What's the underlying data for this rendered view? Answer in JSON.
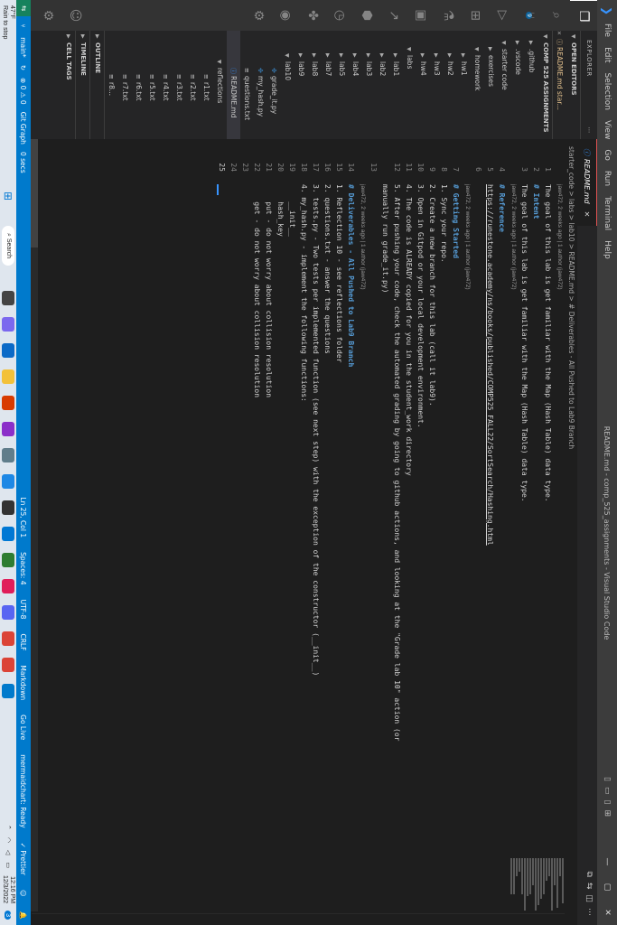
{
  "window": {
    "menu": [
      "File",
      "Edit",
      "Selection",
      "View",
      "Go",
      "Run",
      "Terminal",
      "Help"
    ],
    "title": "README.md - comp_525_assignments - Visual Studio Code"
  },
  "explorer": {
    "header": "EXPLORER",
    "open_editors_label": "OPEN EDITORS",
    "open_editor_item": "README.md  star...",
    "workspace_label": "COMP 525 ASSIGNMENTS",
    "tree": [
      {
        "name": ".github",
        "type": "folder",
        "depth": 1,
        "open": false
      },
      {
        "name": ".vscode",
        "type": "folder",
        "depth": 1,
        "open": false
      },
      {
        "name": "starter code",
        "type": "folder",
        "depth": 1,
        "open": true
      },
      {
        "name": "exercises",
        "type": "folder",
        "depth": 2,
        "open": false
      },
      {
        "name": "homework",
        "type": "folder",
        "depth": 2,
        "open": true
      },
      {
        "name": "hw1",
        "type": "folder",
        "depth": 3,
        "open": false
      },
      {
        "name": "hw2",
        "type": "folder",
        "depth": 3,
        "open": false
      },
      {
        "name": "hw3",
        "type": "folder",
        "depth": 3,
        "open": false
      },
      {
        "name": "hw4",
        "type": "folder",
        "depth": 3,
        "open": false
      },
      {
        "name": "labs",
        "type": "folder",
        "depth": 2,
        "open": true
      },
      {
        "name": "lab1",
        "type": "folder",
        "depth": 3,
        "open": false
      },
      {
        "name": "lab2",
        "type": "folder",
        "depth": 3,
        "open": false
      },
      {
        "name": "lab3",
        "type": "folder",
        "depth": 3,
        "open": false
      },
      {
        "name": "lab4",
        "type": "folder",
        "depth": 3,
        "open": false
      },
      {
        "name": "lab5",
        "type": "folder",
        "depth": 3,
        "open": false
      },
      {
        "name": "lab7",
        "type": "folder",
        "depth": 3,
        "open": false
      },
      {
        "name": "lab8",
        "type": "folder",
        "depth": 3,
        "open": false
      },
      {
        "name": "lab9",
        "type": "folder",
        "depth": 3,
        "open": false
      },
      {
        "name": "lab10",
        "type": "folder",
        "depth": 3,
        "open": true
      },
      {
        "name": "grade_it.py",
        "type": "py",
        "depth": 4
      },
      {
        "name": "my_hash.py",
        "type": "py",
        "depth": 4
      },
      {
        "name": "questions.txt",
        "type": "txt",
        "depth": 4
      },
      {
        "name": "README.md",
        "type": "md",
        "depth": 4,
        "selected": true
      },
      {
        "name": "reflections",
        "type": "folder",
        "depth": 4,
        "open": true
      },
      {
        "name": "r1.txt",
        "type": "txt",
        "depth": 5
      },
      {
        "name": "r2.txt",
        "type": "txt",
        "depth": 5
      },
      {
        "name": "r3.txt",
        "type": "txt",
        "depth": 5
      },
      {
        "name": "r4.txt",
        "type": "txt",
        "depth": 5
      },
      {
        "name": "r5.txt",
        "type": "txt",
        "depth": 5
      },
      {
        "name": "r6.txt",
        "type": "txt",
        "depth": 5
      },
      {
        "name": "r7.txt",
        "type": "txt",
        "depth": 5
      },
      {
        "name": "r8...",
        "type": "txt",
        "depth": 5
      }
    ],
    "sections": [
      "OUTLINE",
      "TIMELINE",
      "CELL TAGS"
    ]
  },
  "editor": {
    "tab_label": "README.md",
    "breadcrumb": "starter_code > labs > lab10 > README.md > # Deliverables - All Pushed to Lab9 Branch",
    "lines": [
      {
        "n": "1",
        "lens": "jaw472, 2 weeks ago | 1 author (jaw472)",
        "text": "The goal of this lab is get familiar with the Map (Hash Table) data type.",
        "kind": "txt"
      },
      {
        "n": "2",
        "text": "# Intent",
        "kind": "h"
      },
      {
        "n": "3",
        "text": "The goal of this lab is get familiar with the Map (Hash Table) data type.",
        "kind": "txt"
      },
      {
        "n": "",
        "lens": "jaw472, 2 weeks ago | 1 author (jaw472)",
        "text": "",
        "kind": "txt"
      },
      {
        "n": "4",
        "text": "# Reference",
        "kind": "h"
      },
      {
        "n": "5",
        "text": "https://runestone.academy/ns/books/published/COMP525_FALL22/SortSearch/Hashing.html",
        "kind": "link"
      },
      {
        "n": "6",
        "text": "",
        "kind": "txt"
      },
      {
        "n": "",
        "lens": "jaw472, 2 weeks ago | 1 author (jaw472)",
        "text": "",
        "kind": "txt"
      },
      {
        "n": "7",
        "text": "# Getting Started",
        "kind": "h"
      },
      {
        "n": "8",
        "text": "1. Sync your repo.",
        "kind": "li"
      },
      {
        "n": "9",
        "text": "2. Create a new branch for this lab (call it lab9).",
        "kind": "li"
      },
      {
        "n": "10",
        "text": "3. Open in Gitpod or your local development environment.",
        "kind": "li"
      },
      {
        "n": "11",
        "text": "4. The code is ALREADY copied for you in the student_work directory",
        "kind": "li"
      },
      {
        "n": "12",
        "text": "5. After pushing your code, check the automated grading by going to github actions, and looking at the \"Grade lab 10\" action (or",
        "kind": "li"
      },
      {
        "n": "",
        "text": "manually run grade_it.py)",
        "kind": "txt"
      },
      {
        "n": "13",
        "text": "",
        "kind": "txt"
      },
      {
        "n": "",
        "lens": "jaw472, 2 weeks ago | 1 author (jaw472)",
        "text": "",
        "kind": "txt"
      },
      {
        "n": "14",
        "text": "# Deliverables - All Pushed to Lab9 Branch",
        "kind": "h"
      },
      {
        "n": "15",
        "text": "1. Reflection 10 - see reflections folder",
        "kind": "li"
      },
      {
        "n": "16",
        "text": "2. questions.txt - answer the questions",
        "kind": "li"
      },
      {
        "n": "17",
        "text": "3. tests.py - Two tests per implemented function (see next step) with the exception of the constructor (__init__)",
        "kind": "li"
      },
      {
        "n": "18",
        "text": "4. my_hash.py - implement the following functions:",
        "kind": "li"
      },
      {
        "n": "19",
        "text": "    __init__",
        "kind": "txt"
      },
      {
        "n": "20",
        "text": "    hash_key",
        "kind": "txt"
      },
      {
        "n": "21",
        "text": "    put - do not worry about collision resolution",
        "kind": "txt"
      },
      {
        "n": "22",
        "text": "    get - do not worry about collision resolution",
        "kind": "txt"
      },
      {
        "n": "23",
        "text": "",
        "kind": "txt"
      },
      {
        "n": "24",
        "text": "",
        "kind": "txt"
      },
      {
        "n": "25",
        "text": "",
        "kind": "cur"
      }
    ]
  },
  "statusbar": {
    "branch": "main*",
    "sync": "↻",
    "problems": "⊗ 0 ⚠ 0",
    "git_graph": "Git Graph",
    "timer": "0 secs",
    "cursor_pos": "Ln 25, Col 1",
    "spaces": "Spaces: 4",
    "encoding": "UTF-8",
    "eol": "CRLF",
    "language": "Markdown",
    "golive": "Go Live",
    "mermaid": "mermaidchart: Ready",
    "prettier": "✓ Prettier"
  },
  "taskbar": {
    "temp": "47°F",
    "weather": "Rain to stop",
    "search": "Search",
    "time": "12:16 PM",
    "date": "12/3/2022",
    "notif": "3"
  }
}
